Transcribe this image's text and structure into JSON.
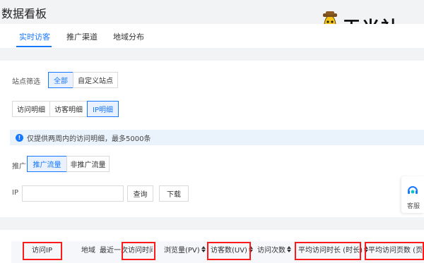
{
  "page": {
    "title": "数据看板"
  },
  "tabs": [
    {
      "label": "实时访客",
      "active": true
    },
    {
      "label": "推广渠道",
      "active": false
    },
    {
      "label": "地域分布",
      "active": false
    }
  ],
  "logo": {
    "text": "玉米社"
  },
  "site_filter": {
    "label": "站点筛选",
    "options": [
      "全部",
      "自定义站点"
    ],
    "selected": "全部"
  },
  "detail_tabs": {
    "options": [
      "访问明细",
      "访客明细",
      "IP明细"
    ],
    "selected": "IP明细"
  },
  "notice": {
    "icon": "info-icon",
    "text": "仅提供两周内的访问明细，最多5000条"
  },
  "promo_filter": {
    "label": "推广",
    "options": [
      "推广流量",
      "非推广流量"
    ],
    "selected": "推广流量"
  },
  "ip_search": {
    "label": "IP",
    "value": "",
    "placeholder": "",
    "query_label": "查询",
    "download_label": "下载"
  },
  "service": {
    "label": "客服",
    "icon": "headset-icon"
  },
  "table": {
    "columns": [
      "访问IP",
      "地域",
      "最近一次访问时间",
      "浏览量(PV)",
      "访客数(UV)",
      "访问次数",
      "平均访问时长 (时长)",
      "平均访问页数 (页)"
    ]
  },
  "colors": {
    "accent": "#1677ff",
    "highlight": "#ff1a1a",
    "background": "#f2f3f5"
  }
}
